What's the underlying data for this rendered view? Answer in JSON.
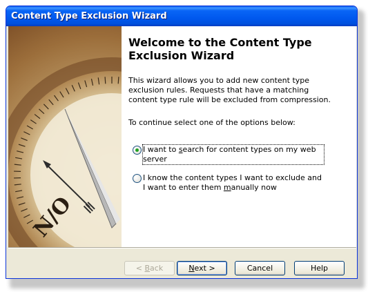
{
  "window": {
    "title": "Content Type Exclusion Wizard"
  },
  "sidebar": {
    "image": "compass-dial-image"
  },
  "main": {
    "heading": "Welcome to the Content Type Exclusion Wizard",
    "intro": "This wizard allows you to add new content type exclusion rules. Requests that have a matching content type rule will be excluded from compression.",
    "prompt": "To continue select one of the options below:"
  },
  "options": [
    {
      "pre": "I want to ",
      "accel": "s",
      "post": "earch for content types on my web server",
      "selected": true
    },
    {
      "pre": "I know the content types I want to exclude and I want to enter them ",
      "accel": "m",
      "post": "anually now",
      "selected": false
    }
  ],
  "buttons": {
    "back": {
      "pre": "< ",
      "accel": "B",
      "post": "ack",
      "enabled": false
    },
    "next": {
      "pre": "",
      "accel": "N",
      "post": "ext >",
      "enabled": true
    },
    "cancel": "Cancel",
    "help": "Help"
  },
  "colors": {
    "titlebar": "#0058ee",
    "dialog_bg": "#ece9d8",
    "radio_dot": "#21a121"
  }
}
